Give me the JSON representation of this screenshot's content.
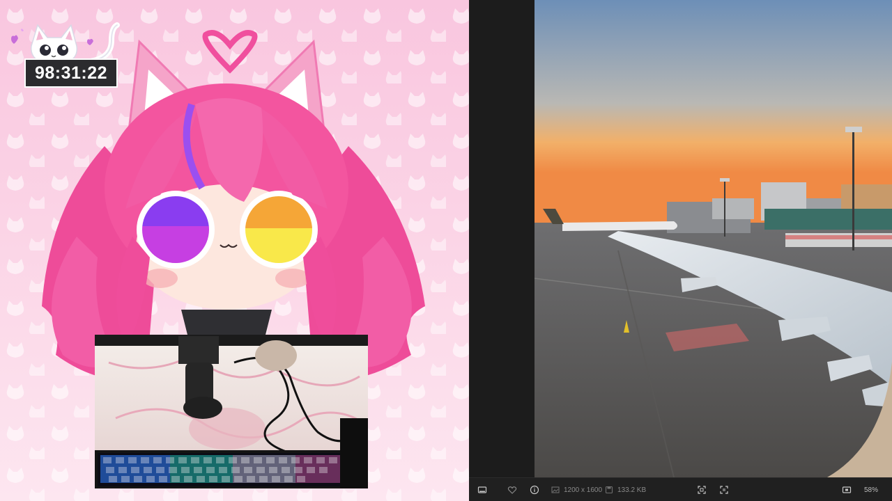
{
  "stream_overlay": {
    "timer": {
      "value": "98:31:22"
    }
  },
  "photo_viewer": {
    "status_bar": {
      "dimensions": "1200 x 1600",
      "file_size": "133.2 KB",
      "zoom": "58%"
    },
    "icons": {
      "filmstrip": "filmstrip-icon",
      "favorite": "heart-icon",
      "info": "info-icon",
      "dimensions": "image-dimensions-icon",
      "file_size": "disk-icon",
      "fit": "fit-to-window-icon",
      "actual_size": "actual-size-icon",
      "mini": "picture-in-picture-icon"
    }
  },
  "colors": {
    "overlay_pink": "#f9c6df",
    "hair_pink": "#f0519c",
    "viewer_bg": "#1f1f1f",
    "statusbar_bg": "#202020"
  }
}
